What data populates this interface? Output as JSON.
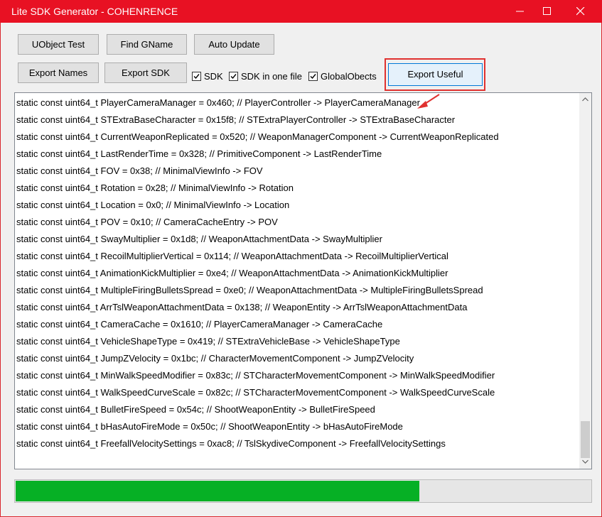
{
  "window": {
    "title": "Lite SDK Generator - COHENRENCE"
  },
  "toolbar": {
    "uobject_test": "UObject Test",
    "find_gname": "Find GName",
    "auto_update": "Auto Update",
    "export_names": "Export Names",
    "export_sdk": "Export SDK",
    "export_useful": "Export Useful"
  },
  "options": {
    "sdk": {
      "label": "SDK",
      "checked": true
    },
    "sdk_one_file": {
      "label": "SDK in one file",
      "checked": true
    },
    "global_objects": {
      "label": "GlobalObects",
      "checked": true
    }
  },
  "log": {
    "lines": [
      "static const uint64_t PlayerCameraManager = 0x460; // PlayerController -> PlayerCameraManager",
      "static const uint64_t STExtraBaseCharacter = 0x15f8; // STExtraPlayerController -> STExtraBaseCharacter",
      "static const uint64_t CurrentWeaponReplicated = 0x520; // WeaponManagerComponent -> CurrentWeaponReplicated",
      "static const uint64_t LastRenderTime = 0x328; // PrimitiveComponent -> LastRenderTime",
      "static const uint64_t FOV = 0x38; // MinimalViewInfo -> FOV",
      "static const uint64_t Rotation = 0x28; // MinimalViewInfo -> Rotation",
      "static const uint64_t Location = 0x0; // MinimalViewInfo -> Location",
      "static const uint64_t POV = 0x10; // CameraCacheEntry -> POV",
      "static const uint64_t SwayMultiplier = 0x1d8; // WeaponAttachmentData -> SwayMultiplier",
      "static const uint64_t RecoilMultiplierVertical = 0x114; // WeaponAttachmentData -> RecoilMultiplierVertical",
      "static const uint64_t AnimationKickMultiplier = 0xe4; // WeaponAttachmentData -> AnimationKickMultiplier",
      "static const uint64_t MultipleFiringBulletsSpread = 0xe0; // WeaponAttachmentData -> MultipleFiringBulletsSpread",
      "static const uint64_t ArrTslWeaponAttachmentData = 0x138; // WeaponEntity -> ArrTslWeaponAttachmentData",
      "static const uint64_t CameraCache = 0x1610; // PlayerCameraManager -> CameraCache",
      "static const uint64_t VehicleShapeType = 0x419; // STExtraVehicleBase -> VehicleShapeType",
      "static const uint64_t JumpZVelocity = 0x1bc; // CharacterMovementComponent -> JumpZVelocity",
      "static const uint64_t MinWalkSpeedModifier = 0x83c; // STCharacterMovementComponent -> MinWalkSpeedModifier",
      "static const uint64_t WalkSpeedCurveScale = 0x82c; // STCharacterMovementComponent -> WalkSpeedCurveScale",
      "static const uint64_t BulletFireSpeed = 0x54c; // ShootWeaponEntity -> BulletFireSpeed",
      "static const uint64_t bHasAutoFireMode = 0x50c; // ShootWeaponEntity -> bHasAutoFireMode",
      "static const uint64_t FreefallVelocitySettings = 0xac8; // TslSkydiveComponent -> FreefallVelocitySettings"
    ]
  },
  "progress": {
    "fraction": 0.7
  },
  "colors": {
    "titlebar": "#e81123",
    "progress": "#06b025",
    "annotation": "#e0312f"
  },
  "icons": [
    "minimize-icon",
    "maximize-icon",
    "close-icon",
    "checkmark-icon",
    "scroll-up-icon",
    "scroll-down-icon",
    "arrow-pointer-icon"
  ]
}
